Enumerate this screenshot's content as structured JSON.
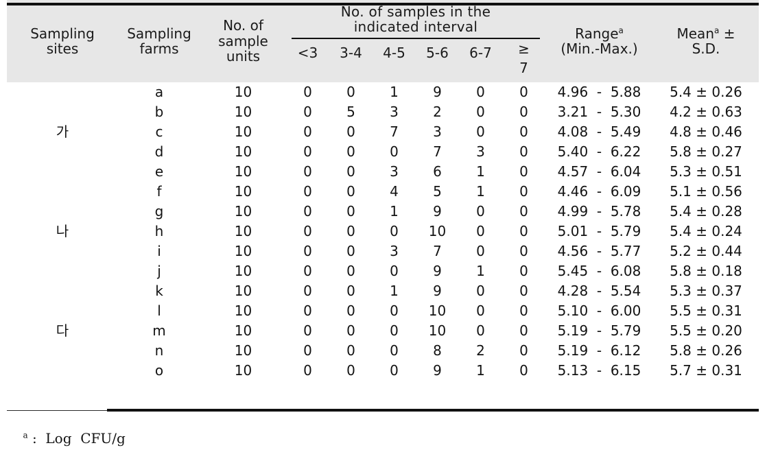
{
  "table": {
    "header": {
      "col_sampling_sites": "Sampling\nsites",
      "col_sampling_farms": "Sampling\nfarms",
      "col_sample_units": "No. of\nsample\nunits",
      "group_intervals_line1": "No. of   samples  in  the",
      "group_intervals_line2": "indicated  interval",
      "interval_bins": [
        "<3",
        "3-4",
        "4-5",
        "5-6",
        "6-7"
      ],
      "interval_bin_ge_symbol": "≥",
      "interval_bin_ge_number": "7",
      "col_range_label": "Range",
      "col_range_sup": "a",
      "col_range_sub": "(Min.-Max.)",
      "col_mean_label": "Mean",
      "col_mean_sup": "a",
      "col_mean_plusminus": " ±",
      "col_mean_sub": "S.D."
    },
    "groups": [
      {
        "site": "가",
        "site_row_index": 2,
        "rows": [
          {
            "farm": "a",
            "units": "10",
            "bins": [
              "0",
              "0",
              "1",
              "9",
              "0",
              "0"
            ],
            "range": "4.96  -  5.88",
            "mean": "5.4 ± 0.26"
          },
          {
            "farm": "b",
            "units": "10",
            "bins": [
              "0",
              "5",
              "3",
              "2",
              "0",
              "0"
            ],
            "range": "3.21  -  5.30",
            "mean": "4.2 ± 0.63"
          },
          {
            "farm": "c",
            "units": "10",
            "bins": [
              "0",
              "0",
              "7",
              "3",
              "0",
              "0"
            ],
            "range": "4.08  -  5.49",
            "mean": "4.8 ± 0.46"
          },
          {
            "farm": "d",
            "units": "10",
            "bins": [
              "0",
              "0",
              "0",
              "7",
              "3",
              "0"
            ],
            "range": "5.40  -  6.22",
            "mean": "5.8 ± 0.27"
          },
          {
            "farm": "e",
            "units": "10",
            "bins": [
              "0",
              "0",
              "3",
              "6",
              "1",
              "0"
            ],
            "range": "4.57  -  6.04",
            "mean": "5.3 ± 0.51"
          },
          {
            "farm": "f",
            "units": "10",
            "bins": [
              "0",
              "0",
              "4",
              "5",
              "1",
              "0"
            ],
            "range": "4.46  -  6.09",
            "mean": "5.1 ± 0.56"
          }
        ]
      },
      {
        "site": "나",
        "site_row_index": 1,
        "rows": [
          {
            "farm": "g",
            "units": "10",
            "bins": [
              "0",
              "0",
              "1",
              "9",
              "0",
              "0"
            ],
            "range": "4.99  -  5.78",
            "mean": "5.4 ± 0.28"
          },
          {
            "farm": "h",
            "units": "10",
            "bins": [
              "0",
              "0",
              "0",
              "10",
              "0",
              "0"
            ],
            "range": "5.01  -  5.79",
            "mean": "5.4 ± 0.24"
          },
          {
            "farm": "i",
            "units": "10",
            "bins": [
              "0",
              "0",
              "3",
              "7",
              "0",
              "0"
            ],
            "range": "4.56  -  5.77",
            "mean": "5.2 ± 0.44"
          },
          {
            "farm": "j",
            "units": "10",
            "bins": [
              "0",
              "0",
              "0",
              "9",
              "1",
              "0"
            ],
            "range": "5.45  -  6.08",
            "mean": "5.8 ± 0.18"
          },
          {
            "farm": "k",
            "units": "10",
            "bins": [
              "0",
              "0",
              "1",
              "9",
              "0",
              "0"
            ],
            "range": "4.28  -  5.54",
            "mean": "5.3 ± 0.37"
          },
          {
            "farm": "l",
            "units": "10",
            "bins": [
              "0",
              "0",
              "0",
              "10",
              "0",
              "0"
            ],
            "range": "5.10  -  6.00",
            "mean": "5.5 ± 0.31"
          }
        ]
      },
      {
        "site": "다",
        "site_row_index": 0,
        "rows": [
          {
            "farm": "m",
            "units": "10",
            "bins": [
              "0",
              "0",
              "0",
              "10",
              "0",
              "0"
            ],
            "range": "5.19  -  5.79",
            "mean": "5.5 ± 0.20"
          },
          {
            "farm": "n",
            "units": "10",
            "bins": [
              "0",
              "0",
              "0",
              "8",
              "2",
              "0"
            ],
            "range": "5.19  -  6.12",
            "mean": "5.8 ± 0.26"
          },
          {
            "farm": "o",
            "units": "10",
            "bins": [
              "0",
              "0",
              "0",
              "9",
              "1",
              "0"
            ],
            "range": "5.13  -  6.15",
            "mean": "5.7 ± 0.31"
          }
        ]
      }
    ],
    "footnote": {
      "sup": "a",
      "text": " :  Log  CFU/g"
    }
  }
}
